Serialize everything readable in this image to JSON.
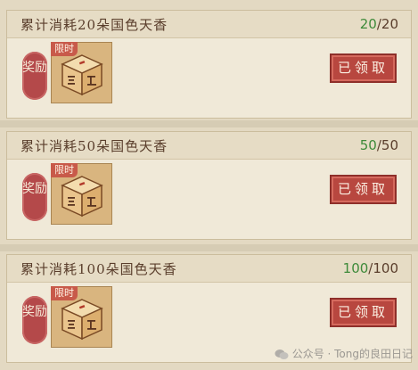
{
  "tasks": [
    {
      "title": "累计消耗20朵国色天香",
      "progress_current": "20",
      "progress_sep": "/",
      "progress_total": "20",
      "reward_label": "奖励",
      "limited_tag": "限时",
      "claim_button": "已领取",
      "item_icon": "dice-icon"
    },
    {
      "title": "累计消耗50朵国色天香",
      "progress_current": "50",
      "progress_sep": "/",
      "progress_total": "50",
      "reward_label": "奖励",
      "limited_tag": "限时",
      "claim_button": "已领取",
      "item_icon": "dice-icon"
    },
    {
      "title": "累计消耗100朵国色天香",
      "progress_current": "100",
      "progress_sep": "/",
      "progress_total": "100",
      "reward_label": "奖励",
      "limited_tag": "限时",
      "claim_button": "已领取",
      "item_icon": "dice-icon"
    }
  ],
  "watermark": {
    "text": "公众号 · Tong的良田日记",
    "icon": "wechat-icon"
  },
  "colors": {
    "progress_done": "#3e8a3a",
    "button_red": "#b8473f",
    "reward_red": "#b4494a"
  }
}
